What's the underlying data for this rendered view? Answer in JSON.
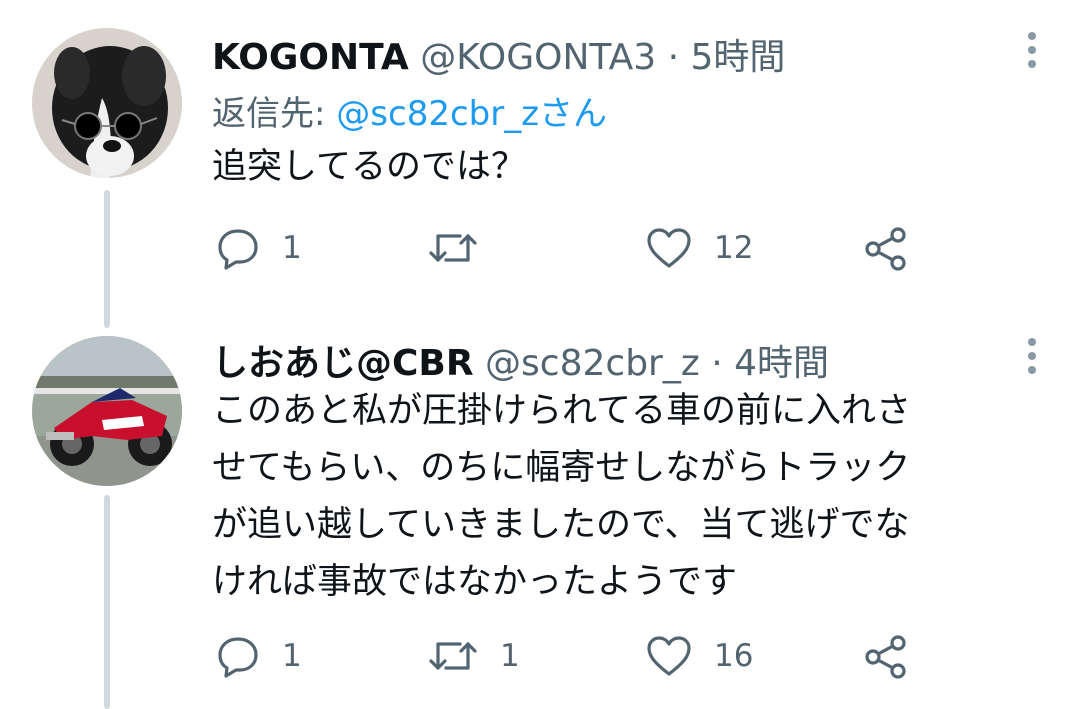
{
  "tweets": [
    {
      "name": "KOGONTA",
      "handle": "@KOGONTA3",
      "separator": "·",
      "time": "5時間",
      "reply_prefix": "返信先:",
      "reply_mention": "@sc82cbr_zさん",
      "text_lines": [
        "追突してるのでは？"
      ],
      "reply_count": "1",
      "retweet_count": "",
      "like_count": "12",
      "avatar": "dog-with-sunglasses"
    },
    {
      "name": "しおあじ@CBR",
      "handle": "@sc82cbr_z",
      "separator": "·",
      "time": "4時間",
      "text_lines": [
        "このあと私が圧掛けられてる車の前に入れさ",
        "せてもらい、のちに幅寄せしながらトラック",
        "が追い越していきましたので、当て逃げでな",
        "ければ事故ではなかったようです"
      ],
      "reply_count": "1",
      "retweet_count": "1",
      "like_count": "16",
      "avatar": "red-motorcycle"
    }
  ],
  "icons": {
    "reply": "reply-bubble-icon",
    "retweet": "retweet-icon",
    "like": "heart-icon",
    "share": "share-icon",
    "more": "more-vertical-icon"
  },
  "colors": {
    "text": "#0f1419",
    "muted": "#536471",
    "link": "#1d9bf0",
    "thread_line": "#cfd9de"
  }
}
